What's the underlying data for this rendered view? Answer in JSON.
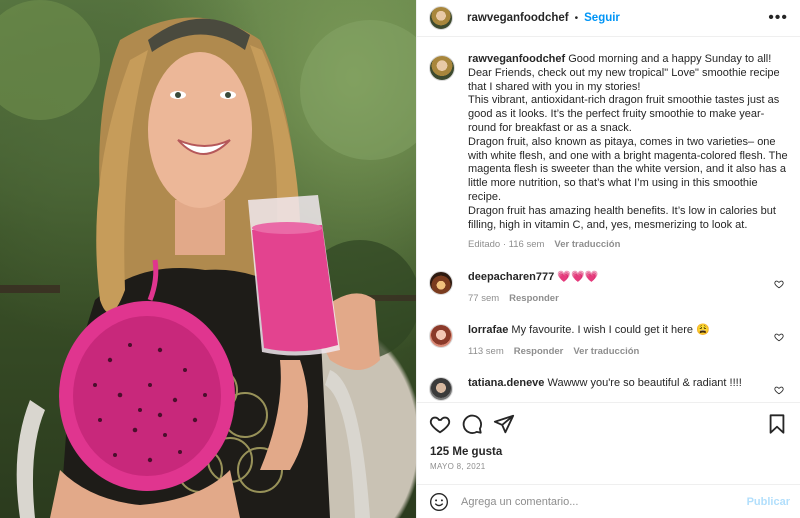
{
  "post": {
    "username": "rawveganfoodchef",
    "separator": "•",
    "follow_label": "Seguir",
    "more_icon": "more-options-icon"
  },
  "caption": {
    "username": "rawveganfoodchef",
    "first_line": "Good morning and a happy Sunday to all!",
    "body": "\nDear Friends, check out my new tropical\" Love\" smoothie recipe that I shared with you in my stories!\nThis vibrant, antioxidant-rich dragon fruit smoothie tastes just as good as it looks. It’s the perfect fruity smoothie to make year-round for breakfast or as a snack.\nDragon fruit, also known as pitaya, comes in two varieties– one with white flesh, and one with a bright magenta-colored flesh. The magenta flesh is sweeter than the white version, and it also has a little more nutrition, so that’s what I’m using in this smoothie recipe.\nDragon fruit has amazing health benefits. It’s low in calories but filling, high in vitamin C, and, yes, mesmerizing to look at.",
    "edited": "Editado · 116 sem",
    "translation": "Ver traducción"
  },
  "comments": [
    {
      "username": "deepacharen777",
      "text": "💗💗💗",
      "time": "77 sem",
      "reply": "Responder",
      "translation": ""
    },
    {
      "username": "lorrafae",
      "text": "My favourite. I wish I could get it here 😩",
      "time": "113 sem",
      "reply": "Responder",
      "translation": "Ver traducción"
    },
    {
      "username": "tatiana.deneve",
      "text": "Wawww you're so beautiful & radiant !!!!",
      "time": "",
      "reply": "",
      "translation": ""
    }
  ],
  "stats": {
    "likes": "125 Me gusta",
    "date": "MAYO 8, 2021"
  },
  "composer": {
    "placeholder": "Agrega un comentario...",
    "post_label": "Publicar"
  },
  "colors": {
    "accent": "#0095f6",
    "muted": "#8e8e8e",
    "post_disabled": "#b2dffc",
    "dragonfruit": "#e0358f"
  }
}
